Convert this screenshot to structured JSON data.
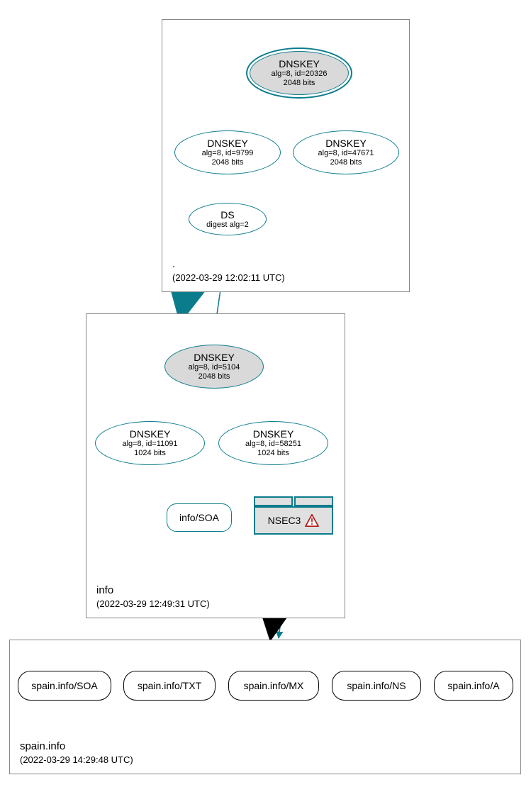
{
  "colors": {
    "teal": "#0b7c8c",
    "node_fill_grey": "#d9d9d9",
    "box_border": "#888888",
    "warn_red": "#b01717"
  },
  "zones": {
    "root": {
      "name": ".",
      "timestamp": "(2022-03-29 12:02:11 UTC)"
    },
    "info": {
      "name": "info",
      "timestamp": "(2022-03-29 12:49:31 UTC)"
    },
    "spain": {
      "name": "spain.info",
      "timestamp": "(2022-03-29 14:29:48 UTC)"
    }
  },
  "nodes": {
    "root_dnskey_20326": {
      "title": "DNSKEY",
      "line2": "alg=8, id=20326",
      "line3": "2048 bits"
    },
    "root_dnskey_9799": {
      "title": "DNSKEY",
      "line2": "alg=8, id=9799",
      "line3": "2048 bits"
    },
    "root_dnskey_47671": {
      "title": "DNSKEY",
      "line2": "alg=8, id=47671",
      "line3": "2048 bits"
    },
    "root_ds": {
      "title": "DS",
      "line2": "digest alg=2"
    },
    "info_dnskey_5104": {
      "title": "DNSKEY",
      "line2": "alg=8, id=5104",
      "line3": "2048 bits"
    },
    "info_dnskey_11091": {
      "title": "DNSKEY",
      "line2": "alg=8, id=11091",
      "line3": "1024 bits"
    },
    "info_dnskey_58251": {
      "title": "DNSKEY",
      "line2": "alg=8, id=58251",
      "line3": "1024 bits"
    },
    "info_soa": {
      "title": "info/SOA"
    },
    "nsec3": {
      "title": "NSEC3"
    },
    "spain_soa": {
      "title": "spain.info/SOA"
    },
    "spain_txt": {
      "title": "spain.info/TXT"
    },
    "spain_mx": {
      "title": "spain.info/MX"
    },
    "spain_ns": {
      "title": "spain.info/NS"
    },
    "spain_a": {
      "title": "spain.info/A"
    }
  }
}
